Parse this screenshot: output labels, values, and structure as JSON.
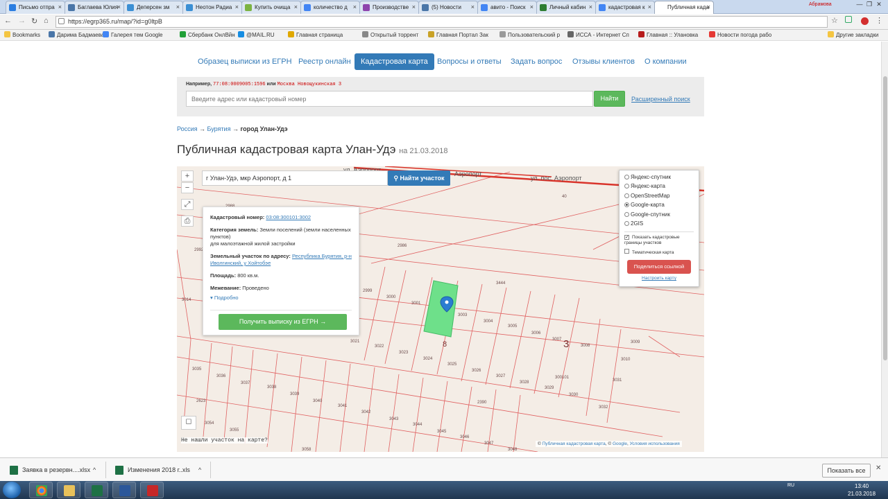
{
  "browser": {
    "tabs": [
      {
        "label": "Письмо отпра",
        "color": "#2a7de1"
      },
      {
        "label": "Баглаева Юлия",
        "color": "#4a76a8"
      },
      {
        "label": "Деперсен зм",
        "color": "#3b8fd4"
      },
      {
        "label": "Неотон Радиа",
        "color": "#3b8fd4"
      },
      {
        "label": "Купить очища",
        "color": "#7cb342"
      },
      {
        "label": "количество д",
        "color": "#4285f4"
      },
      {
        "label": "Производстве",
        "color": "#8e44ad"
      },
      {
        "label": "(5) Новости",
        "color": "#4a76a8"
      },
      {
        "label": "авито - Поиск",
        "color": "#4285f4"
      },
      {
        "label": "Личный кабин",
        "color": "#2e7d32"
      },
      {
        "label": "кадастровая к",
        "color": "#4285f4"
      },
      {
        "label": "Публичная када",
        "color": "#ffffff"
      }
    ],
    "profile_label": "Абрамова",
    "url": "https://egrp365.ru/map/?id=g0ltpB",
    "bookmarks": [
      {
        "label": "Bookmarks",
        "color": "#f4c542"
      },
      {
        "label": "Дарима Бадмаева",
        "color": "#4a76a8"
      },
      {
        "label": "Галерея тем Google",
        "color": "#4285f4"
      },
      {
        "label": "Сбербанк ОнлВйн",
        "color": "#21a038"
      },
      {
        "label": "@MAIL.RU",
        "color": "#168de2"
      },
      {
        "label": "Главная страница",
        "color": "#e0a800"
      },
      {
        "label": "Открытый торрент",
        "color": "#888888"
      },
      {
        "label": "Главная Портал Зак",
        "color": "#c9a227"
      },
      {
        "label": "Пользовательский р",
        "color": "#999999"
      },
      {
        "label": "ИССА - Интернет Сп",
        "color": "#666666"
      },
      {
        "label": "Главная :: Улановка",
        "color": "#b71c1c"
      },
      {
        "label": "Новости погода рабо",
        "color": "#e53935"
      }
    ],
    "other_bookmarks": "Другие закладки"
  },
  "nav": {
    "items": [
      "Образец выписки из ЕГРН",
      "Реестр онлайн",
      "Кадастровая карта",
      "Вопросы и ответы",
      "Задать вопрос",
      "Отзывы клиентов",
      "О компании"
    ]
  },
  "search": {
    "example_prefix": "Например,",
    "example_code": "77:08:0009005:1596",
    "example_or": "или",
    "example_address": "Москва Новощукинская 3",
    "placeholder": "Введите адрес или кадастровый номер",
    "button": "Найти",
    "advanced": "Расширенный поиск"
  },
  "breadcrumb": {
    "root": "Россия",
    "region": "Бурятия",
    "current": "город Улан-Удэ",
    "sep": "→"
  },
  "title": {
    "main": "Публичная кадастровая карта Улан-Удэ",
    "date": "на 21.03.2018"
  },
  "map": {
    "search_value": "г Улан-Удэ, мкр Аэропорт, д 1",
    "find_button": "Найти участок",
    "zoom_in": "+",
    "zoom_out": "−",
    "street_labels": [
      "ул. Аэропорт",
      "Аэропорт",
      "ул. пос. Аэропорт"
    ],
    "parcel_labels": [
      "2988",
      "2992",
      "2986",
      "2999",
      "3000",
      "3001",
      "3003",
      "3004",
      "3005",
      "3006",
      "3007",
      "3008",
      "3009",
      "3010",
      "3444",
      "3014",
      "3021",
      "3022",
      "3023",
      "3024",
      "3025",
      "3026",
      "3027",
      "3028",
      "3029",
      "3030",
      "3031",
      "3032",
      "3035",
      "3036",
      "3037",
      "3038",
      "3039",
      "3040",
      "3041",
      "3042",
      "3043",
      "3044",
      "3045",
      "3046",
      "3047",
      "3048",
      "3054",
      "3055",
      "3058",
      "2623",
      "2390",
      "300101",
      "40"
    ],
    "big_labels": [
      "8",
      "3"
    ],
    "info": {
      "cad_label": "Кадастровый номер:",
      "cad_value": "03:08:300101:3002",
      "category_label": "Категория земель:",
      "category_value": "Земли поселений (земли населенных пунктов)",
      "purpose": "для малоэтажной жилой застройки",
      "address_label": "Земельный участок по адресу:",
      "address_value": "Республика Бурятия, р-н Иволгинский, у Хойтобэе",
      "area_label": "Площадь:",
      "area_value": "800 кв.м.",
      "survey_label": "Межевание:",
      "survey_value": "Проведено",
      "more": "Подробно",
      "get_button": "Получить выписку из ЕГРН →"
    },
    "layers": {
      "options": [
        {
          "label": "Яндекс-спутник",
          "checked": false
        },
        {
          "label": "Яндекс-карта",
          "checked": false
        },
        {
          "label": "OpenStreetMap",
          "checked": false
        },
        {
          "label": "Google-карта",
          "checked": true
        },
        {
          "label": "Google-спутник",
          "checked": false
        },
        {
          "label": "2GIS",
          "checked": false
        }
      ],
      "show_bounds": "Показать кадастровые границы участков",
      "thematic": "Тематическая карта",
      "share": "Поделиться ссылкой",
      "configure": "Настроить карту"
    },
    "not_found": "Не нашли участок на карте?",
    "attribution_prefix": "©",
    "attribution_link1": "Публичная кадастровая карта",
    "attribution_mid": ", ©",
    "attribution_link2": "Google",
    "attribution_link3": "Условия использования"
  },
  "downloads": {
    "items": [
      {
        "label": "Заявка в резервн....xlsx",
        "color": "#1e7145"
      },
      {
        "label": "Изменения 2018 г..xls",
        "color": "#1e7145"
      }
    ],
    "show_all": "Показать все"
  },
  "taskbar": {
    "lang": "RU",
    "time": "13:40",
    "date": "21.03.2018"
  }
}
